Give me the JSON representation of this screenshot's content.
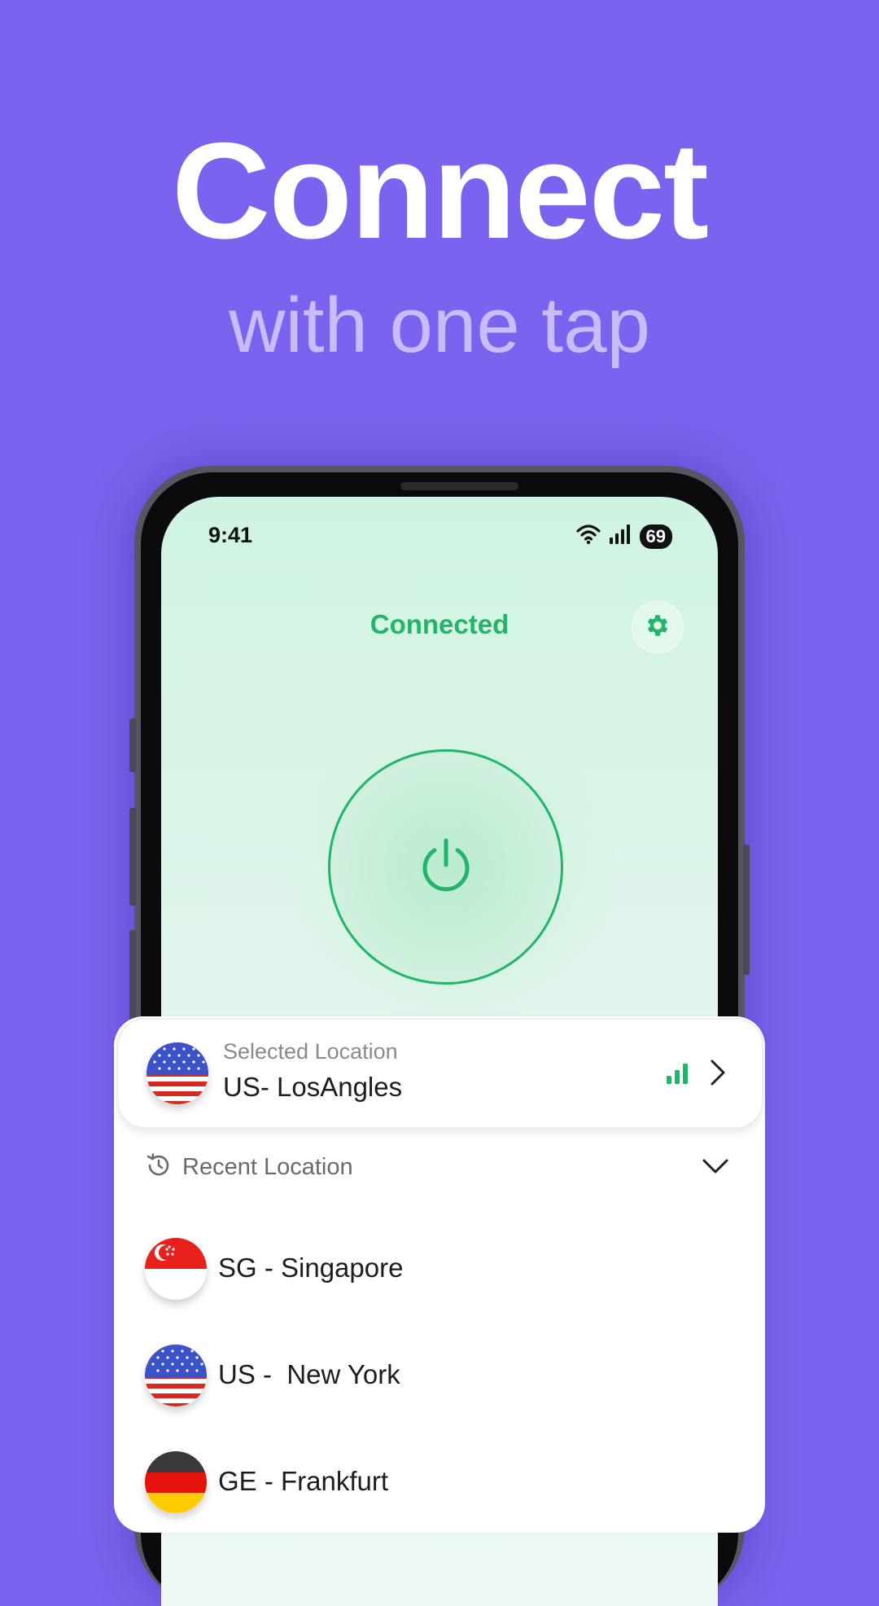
{
  "promo": {
    "headline": "Connect",
    "subheadline": "with one tap"
  },
  "status_bar": {
    "time": "9:41",
    "battery": "69",
    "icons": [
      "wifi-icon",
      "cellular-signal-icon",
      "battery-icon"
    ]
  },
  "app": {
    "status_text": "Connected",
    "settings_icon": "gear-icon",
    "power_icon": "power-icon",
    "accent_color": "#21B56A",
    "background_color": "#7B63EF"
  },
  "selected_location": {
    "label": "Selected Location",
    "value": "US- LosAngles",
    "flag": "us-flag-icon"
  },
  "recent": {
    "label": "Recent Location",
    "items": [
      {
        "name": "SG - Singapore",
        "flag": "singapore-flag-icon"
      },
      {
        "name": "US -  New York",
        "flag": "us-flag-icon"
      },
      {
        "name": "GE - Frankfurt",
        "flag": "germany-flag-icon"
      }
    ]
  }
}
